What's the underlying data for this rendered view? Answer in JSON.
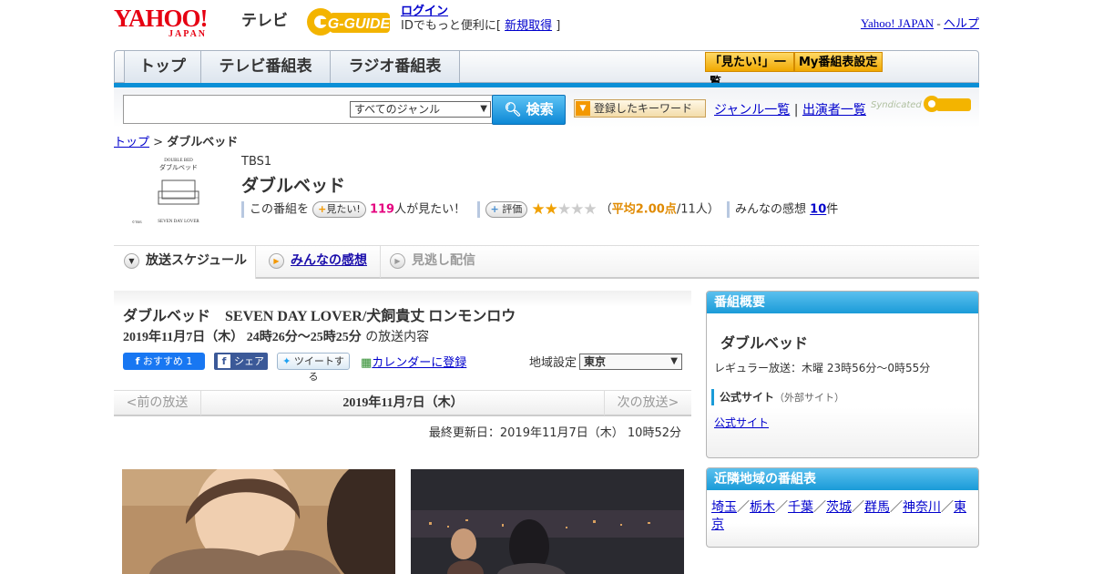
{
  "header": {
    "yahoo_logo_text": "YAHOO!",
    "yahoo_logo_sub": "JAPAN",
    "tv_label": "テレビ",
    "gguide_logo": "G-GUIDE",
    "login_link": "ログイン",
    "login_prompt": "IDでもっと便利に[",
    "register_link": "新規取得",
    "login_suffix": "]",
    "yahoo_japan_link": "Yahoo! JAPAN",
    "separator": " - ",
    "help_link": "ヘルプ"
  },
  "nav": {
    "tabs": [
      {
        "label": "トップ"
      },
      {
        "label": "テレビ番組表"
      },
      {
        "label": "ラジオ番組表"
      }
    ],
    "watchlist_button": "「見たい!」一覧",
    "my_listing_button": "My番組表設定"
  },
  "search": {
    "query_value": "",
    "genre_selected": "すべてのジャンル",
    "search_button": "検索",
    "keyword_button": "登録したキーワード",
    "genre_list_link": "ジャンル一覧",
    "divider": "|",
    "performer_list_link": "出演者一覧",
    "syndicated_text": "Syndicated"
  },
  "breadcrumb": {
    "top_link": "トップ",
    "separator": " > ",
    "current": "ダブルベッド"
  },
  "program": {
    "thumb_text_en": "DOUBLE BED",
    "thumb_text_jp": "ダブルベッド",
    "thumb_text_sub": "SEVEN DAY LOVER",
    "thumb_copyright": "©TBS",
    "station": "TBS1",
    "title": "ダブルベッド",
    "want_prefix": "この番組を",
    "want_button": "見たい!",
    "want_count": "119",
    "want_suffix": "人が見たい！",
    "rating_button": "評価",
    "rating_value": 2,
    "rating_max": 5,
    "rating_open": "（",
    "rating_avg": "平均2.00点",
    "rating_count": "/11人）",
    "impressions_prefix": "みんなの感想",
    "impressions_count": "10",
    "impressions_suffix": "件"
  },
  "subtabs": [
    {
      "label": "放送スケジュール"
    },
    {
      "label": "みんなの感想"
    },
    {
      "label": "見逃し配信"
    }
  ],
  "episode": {
    "title": "ダブルベッド　SEVEN DAY LOVER/犬飼貴丈 ロンモンロウ",
    "datetime": "2019年11月7日（木） 24時26分～25時25分",
    "datetime_suffix": "の放送内容",
    "fb_recommend": "おすすめ 1",
    "fb_share": "シェア",
    "tweet": "ツイートする",
    "calendar_link": "カレンダーに登録",
    "region_label": "地域設定",
    "region_selected": "東京",
    "prev_label": "<前の放送",
    "current_date": "2019年11月7日（木）",
    "next_label": "次の放送>",
    "updated": "最終更新日：2019年11月7日（木）  10時52分"
  },
  "sidebar": {
    "overview_heading": "番組概要",
    "overview_title": "ダブルベッド",
    "regular_broadcast": "レギュラー放送：木曜 23時56分～0時55分",
    "official_label": "公式サイト",
    "official_note": "（外部サイト）",
    "official_link": "公式サイト",
    "nearby_heading": "近隣地域の番組表",
    "nearby_regions": [
      "埼玉",
      "栃木",
      "千葉",
      "茨城",
      "群馬",
      "神奈川",
      "東京"
    ]
  },
  "colors": {
    "accent_blue": "#0b8fd6",
    "yahoo_red": "#e60012",
    "gold": "#f0a800",
    "want_count": "#e4007f"
  }
}
